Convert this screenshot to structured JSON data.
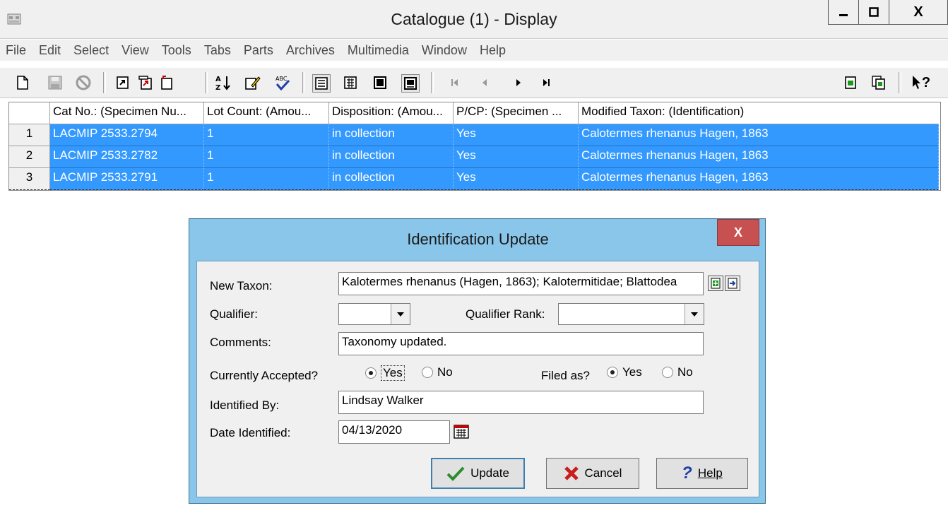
{
  "window": {
    "title": "Catalogue (1) - Display",
    "controls": {
      "minimize": "▁",
      "maximize": "□",
      "close": "X"
    }
  },
  "menu": [
    "File",
    "Edit",
    "Select",
    "View",
    "Tools",
    "Tabs",
    "Parts",
    "Archives",
    "Multimedia",
    "Window",
    "Help"
  ],
  "toolbar": {
    "icons": [
      "new-icon",
      "save-icon",
      "cancel-icon",
      "open-icon",
      "open-multiple-icon",
      "attach-icon",
      "sort-icon",
      "edit-icon",
      "spell-check-icon",
      "details-view-icon",
      "list-view-icon",
      "page-view-icon",
      "image-view-icon",
      "first-record-icon",
      "previous-record-icon",
      "next-record-icon",
      "last-record-icon",
      "copy-record-icon",
      "paste-record-icon",
      "help-pointer-icon"
    ],
    "help_label": "?"
  },
  "grid": {
    "columns": [
      "Cat No.: (Specimen Nu...",
      "Lot Count: (Amou...",
      "Disposition: (Amou...",
      "P/CP: (Specimen ...",
      "Modified Taxon: (Identification)"
    ],
    "rows": [
      {
        "num": "1",
        "cat_no": "LACMIP 2533.2794",
        "lot_count": "1",
        "disposition": "in collection",
        "pcp": "Yes",
        "taxon": "Calotermes rhenanus Hagen, 1863"
      },
      {
        "num": "2",
        "cat_no": "LACMIP 2533.2782",
        "lot_count": "1",
        "disposition": "in collection",
        "pcp": "Yes",
        "taxon": "Calotermes rhenanus Hagen, 1863"
      },
      {
        "num": "3",
        "cat_no": "LACMIP 2533.2791",
        "lot_count": "1",
        "disposition": "in collection",
        "pcp": "Yes",
        "taxon": "Calotermes rhenanus Hagen, 1863"
      }
    ],
    "selection_color": "#3399ff"
  },
  "dialog": {
    "title": "Identification Update",
    "close_label": "X",
    "new_taxon_label": "New Taxon:",
    "new_taxon_value": "Kalotermes rhenanus (Hagen, 1863); Kalotermitidae; Blattodea",
    "qualifier_label": "Qualifier:",
    "qualifier_value": "",
    "qualifier_rank_label": "Qualifier Rank:",
    "qualifier_rank_value": "",
    "comments_label": "Comments:",
    "comments_value": "Taxonomy updated.",
    "currently_accepted_label": "Currently Accepted?",
    "currently_accepted_yes": "Yes",
    "currently_accepted_no": "No",
    "currently_accepted_selected": "Yes",
    "filed_as_label": "Filed as?",
    "filed_as_yes": "Yes",
    "filed_as_no": "No",
    "filed_as_selected": "Yes",
    "identified_by_label": "Identified By:",
    "identified_by_value": "Lindsay Walker",
    "date_identified_label": "Date Identified:",
    "date_identified_value": "04/13/2020",
    "update_label": "Update",
    "cancel_label": "Cancel",
    "help_label": "Help",
    "title_bar_color": "#89c6ea",
    "close_button_color": "#c75050"
  }
}
